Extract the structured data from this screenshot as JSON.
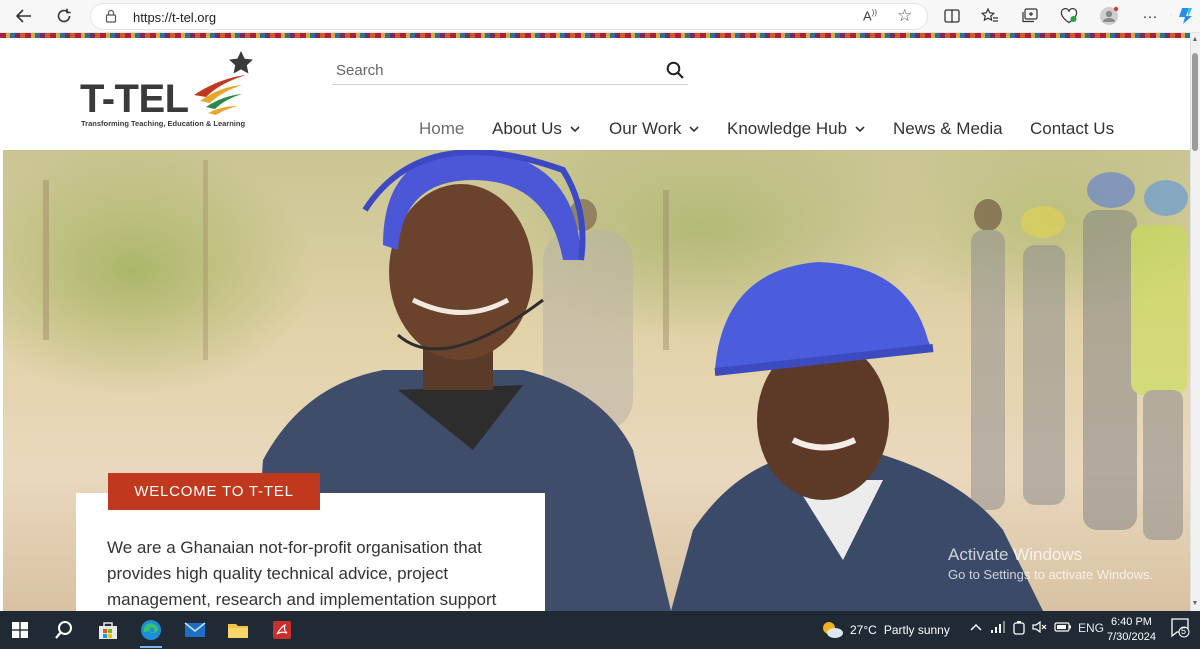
{
  "browser": {
    "url": "https://t-tel.org",
    "read_aloud_label": "A",
    "icons": [
      "back-icon",
      "refresh-icon",
      "lock-icon",
      "read-aloud-icon",
      "favorite-icon",
      "split-screen-icon",
      "favorites-icon",
      "collections-icon",
      "browser-essentials-icon",
      "profile-icon",
      "more-icon",
      "copilot-icon"
    ]
  },
  "site": {
    "logo_text": "T-TEL",
    "logo_tagline": "Transforming Teaching, Education & Learning",
    "search_placeholder": "Search",
    "menu": [
      {
        "label": "Home"
      },
      {
        "label": "About Us"
      },
      {
        "label": "Our Work"
      },
      {
        "label": "Knowledge Hub"
      },
      {
        "label": "News & Media"
      },
      {
        "label": "Contact Us"
      }
    ],
    "welcome_badge": "WELCOME TO T-TEL",
    "welcome_text": "We are a Ghanaian not-for-profit organisation that provides high quality technical advice, project management, research and implementation support",
    "colors": {
      "accent": "#c0391e",
      "text": "#333333"
    }
  },
  "watermark": {
    "title": "Activate Windows",
    "subtitle": "Go to Settings to activate Windows."
  },
  "taskbar": {
    "apps": [
      "windows-start-icon",
      "search-icon",
      "store-icon",
      "edge-icon",
      "mail-icon",
      "file-explorer-icon",
      "pdf-app-icon"
    ],
    "weather_temp": "27°C",
    "weather_desc": "Partly sunny",
    "language": "ENG",
    "time": "6:40 PM",
    "date": "7/30/2024",
    "notification_count": "5"
  }
}
